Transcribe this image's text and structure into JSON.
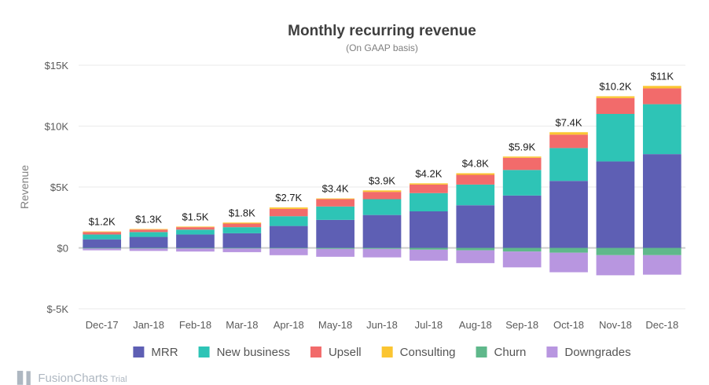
{
  "chart_data": {
    "type": "bar",
    "stacked": true,
    "title": "Monthly recurring revenue",
    "subtitle": "(On GAAP basis)",
    "ylabel": "Revenue",
    "ylim": [
      -5000,
      15000
    ],
    "yticks": [
      15000,
      10000,
      5000,
      0,
      -5000
    ],
    "ytick_labels": [
      "$15K",
      "$10K",
      "$5K",
      "$0",
      "$-5K"
    ],
    "grid": true,
    "legend_position": "bottom",
    "categories": [
      "Dec-17",
      "Jan-18",
      "Feb-18",
      "Mar-18",
      "Apr-18",
      "May-18",
      "Jun-18",
      "Jul-18",
      "Aug-18",
      "Sep-18",
      "Oct-18",
      "Nov-18",
      "Dec-18"
    ],
    "totals": [
      "$1.2K",
      "$1.3K",
      "$1.5K",
      "$1.8K",
      "$2.7K",
      "$3.4K",
      "$3.9K",
      "$4.2K",
      "$4.8K",
      "$5.9K",
      "$7.4K",
      "$10.2K",
      "$11K"
    ],
    "series": [
      {
        "name": "MRR",
        "color": "#5e5fb4",
        "values": [
          700,
          900,
          1100,
          1200,
          1800,
          2300,
          2700,
          3000,
          3500,
          4300,
          5500,
          7100,
          7700
        ]
      },
      {
        "name": "New business",
        "color": "#2ec4b6",
        "values": [
          400,
          400,
          400,
          500,
          800,
          1100,
          1300,
          1500,
          1700,
          2100,
          2700,
          3900,
          4100
        ]
      },
      {
        "name": "Upsell",
        "color": "#f26b6b",
        "values": [
          200,
          200,
          200,
          300,
          600,
          600,
          600,
          700,
          800,
          1000,
          1100,
          1300,
          1300
        ]
      },
      {
        "name": "Consulting",
        "color": "#fbc531",
        "values": [
          50,
          50,
          50,
          80,
          120,
          60,
          120,
          100,
          130,
          100,
          200,
          150,
          200
        ]
      },
      {
        "name": "Churn",
        "color": "#5fb88b",
        "values": [
          -50,
          -50,
          -50,
          -50,
          -50,
          -80,
          -80,
          -150,
          -200,
          -300,
          -400,
          -600,
          -600
        ]
      },
      {
        "name": "Downgrades",
        "color": "#b896e0",
        "values": [
          -150,
          -200,
          -250,
          -300,
          -550,
          -650,
          -700,
          -900,
          -1050,
          -1300,
          -1600,
          -1650,
          -1600
        ]
      }
    ]
  },
  "branding": {
    "name": "FusionCharts",
    "suffix": "Trial"
  }
}
